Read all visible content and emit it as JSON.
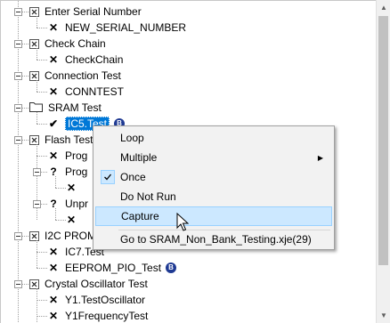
{
  "tree": {
    "items": [
      {
        "label": "Enter Serial Number",
        "type": "group"
      },
      {
        "label": "NEW_SERIAL_NUMBER",
        "type": "x"
      },
      {
        "label": "Check Chain",
        "type": "group"
      },
      {
        "label": "CheckChain",
        "type": "x"
      },
      {
        "label": "Connection Test",
        "type": "group"
      },
      {
        "label": "CONNTEST",
        "type": "x"
      },
      {
        "label": "SRAM Test",
        "type": "folder"
      },
      {
        "label": "IC5.Test",
        "type": "check",
        "selected": true,
        "badge": "B"
      },
      {
        "label": "Flash Test",
        "type": "group"
      },
      {
        "label": "Prog",
        "type": "x"
      },
      {
        "label": "Prog",
        "type": "q"
      },
      {
        "label": "",
        "type": "x"
      },
      {
        "label": "Unpr",
        "type": "q"
      },
      {
        "label": "",
        "type": "x"
      },
      {
        "label": "I2C PROM",
        "type": "group"
      },
      {
        "label": "IC7.Test",
        "type": "x"
      },
      {
        "label": "EEPROM_PIO_Test",
        "type": "x",
        "badge": "B"
      },
      {
        "label": "Crystal Oscillator Test",
        "type": "group"
      },
      {
        "label": "Y1.TestOscillator",
        "type": "x"
      },
      {
        "label": "Y1FrequencyTest",
        "type": "x"
      }
    ]
  },
  "context_menu": {
    "items": [
      {
        "label": "Loop"
      },
      {
        "label": "Multiple",
        "submenu": true
      },
      {
        "label": "Once",
        "checked": true
      },
      {
        "label": "Do Not Run"
      },
      {
        "label": "Capture",
        "hovered": true
      },
      {
        "label": "Go to SRAM_Non_Bank_Testing.xje(29)"
      }
    ]
  },
  "colors": {
    "selection": "#0078d7",
    "hover": "#cce8ff",
    "badge": "#1f3a93"
  }
}
